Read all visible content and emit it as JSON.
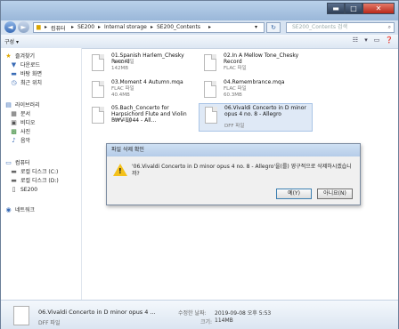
{
  "window": {
    "minimize_glyph": "▬",
    "maximize_glyph": "□",
    "close_glyph": "✕"
  },
  "address": {
    "segments": [
      "컴퓨터",
      "SE200",
      "Internal storage",
      "SE200_Contents"
    ],
    "separator": "▸",
    "search_placeholder": "SE200_Contents 검색"
  },
  "toolbar": {
    "organize_label": "구성 ▾"
  },
  "sidebar": {
    "items": [
      {
        "label": "즐겨찾기",
        "icon": "star-icon",
        "glyph": "★"
      },
      {
        "label": "다운로드",
        "icon": "download-folder-icon",
        "glyph": "▼"
      },
      {
        "label": "바탕 화면",
        "icon": "desktop-icon",
        "glyph": "▬"
      },
      {
        "label": "최근 위치",
        "icon": "recent-places-icon",
        "glyph": "◷"
      },
      {
        "label": "라이브러리",
        "icon": "library-icon",
        "glyph": "▤"
      },
      {
        "label": "문서",
        "icon": "documents-icon",
        "glyph": "▦"
      },
      {
        "label": "비디오",
        "icon": "videos-icon",
        "glyph": "▣"
      },
      {
        "label": "사진",
        "icon": "pictures-icon",
        "glyph": "▩"
      },
      {
        "label": "음악",
        "icon": "music-icon",
        "glyph": "♪"
      },
      {
        "label": "컴퓨터",
        "icon": "computer-icon",
        "glyph": "▭"
      },
      {
        "label": "로컬 디스크 (C:)",
        "icon": "drive-c-icon",
        "glyph": "▬"
      },
      {
        "label": "로컬 디스크 (D:)",
        "icon": "drive-d-icon",
        "glyph": "▬"
      },
      {
        "label": "SE200",
        "icon": "device-icon",
        "glyph": "▯"
      },
      {
        "label": "네트워크",
        "icon": "network-icon",
        "glyph": "◉"
      }
    ]
  },
  "files": [
    {
      "name": "01.Spanish Harlem_Chesky Record",
      "type": "FLAC 파일",
      "size": "142MB"
    },
    {
      "name": "02.In A Mellow Tone_Chesky Record",
      "type": "FLAC 파일",
      "size": ""
    },
    {
      "name": "03.Moment 4 Autumn.mqa",
      "type": "FLAC 파일",
      "size": "40.4MB"
    },
    {
      "name": "04.Remembrance.mqa",
      "type": "FLAC 파일",
      "size": "60.3MB"
    },
    {
      "name": "05.Bach_Concerto for Harpsichord Flute and Violin BWV 1044 - All...",
      "type": "DFF 파일",
      "size": ""
    },
    {
      "name": "06.Vivaldi Concerto in D minor opus 4 no. 8 - Allegro",
      "type": "DFF 파일",
      "size": ""
    }
  ],
  "dialog": {
    "title": "파일 삭제 확인",
    "message": "'06.Vivaldi Concerto in D minor opus 4 no. 8 - Allegro'을(를) 영구적으로 삭제하시겠습니까?",
    "yes_label": "예(Y)",
    "no_label": "아니요(N)"
  },
  "details": {
    "name": "06.Vivaldi Concerto in D minor opus 4 ...",
    "type": "DFF 파일",
    "modified_label": "수정한 날짜:",
    "modified_value": "2019-09-08 오후 5:53",
    "size_label": "크기:",
    "size_value": "114MB"
  }
}
